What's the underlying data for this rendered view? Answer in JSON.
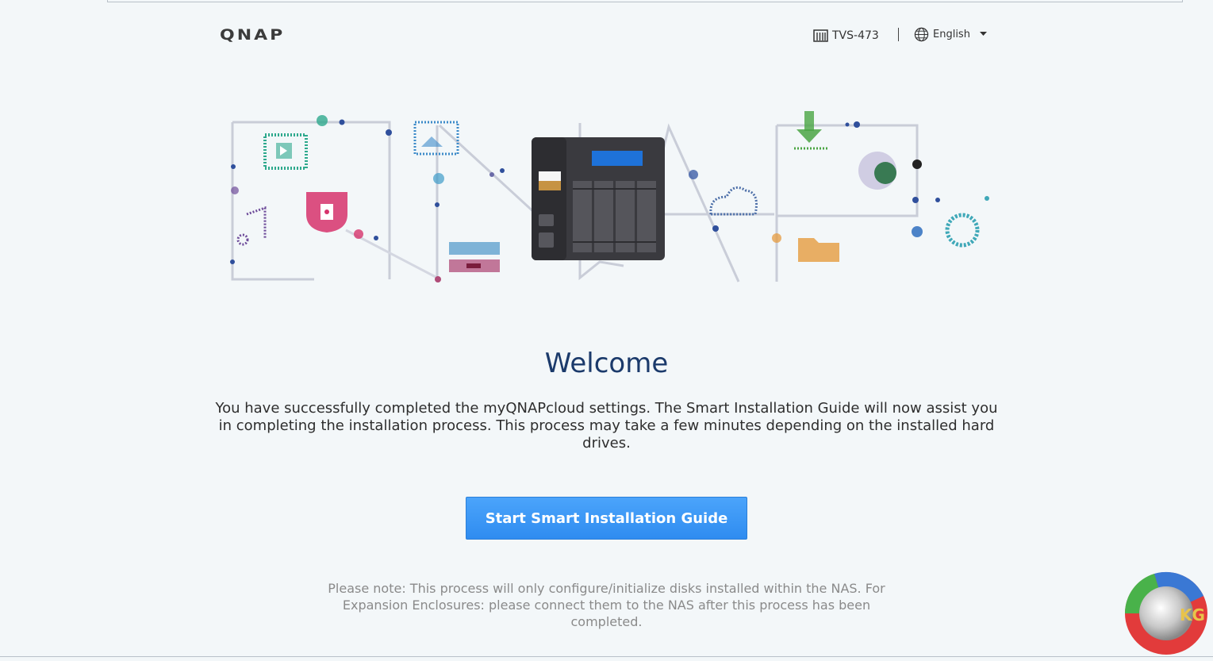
{
  "header": {
    "logo_text": "QNAP",
    "device_model": "TVS-473",
    "language": "English",
    "icons": {
      "device": "nas-device-icon",
      "language": "globe-icon",
      "dropdown": "chevron-down-icon"
    }
  },
  "main": {
    "title": "Welcome",
    "description": "You have successfully completed the myQNAPcloud settings. The Smart Installation Guide will now assist you in completing the installation process. This process may take a few minutes depending on the installed hard drives.",
    "start_button_label": "Start Smart Installation Guide",
    "note": "Please note: This process will only configure/initialize disks installed within the NAS. For Expansion Enclosures: please connect them to the NAS after this process has been completed."
  },
  "colors": {
    "background": "#f3f7f9",
    "title": "#1b3a6b",
    "button": "#3a96f5",
    "note_text": "#8a8a8a"
  },
  "badge": {
    "text": "KG"
  }
}
